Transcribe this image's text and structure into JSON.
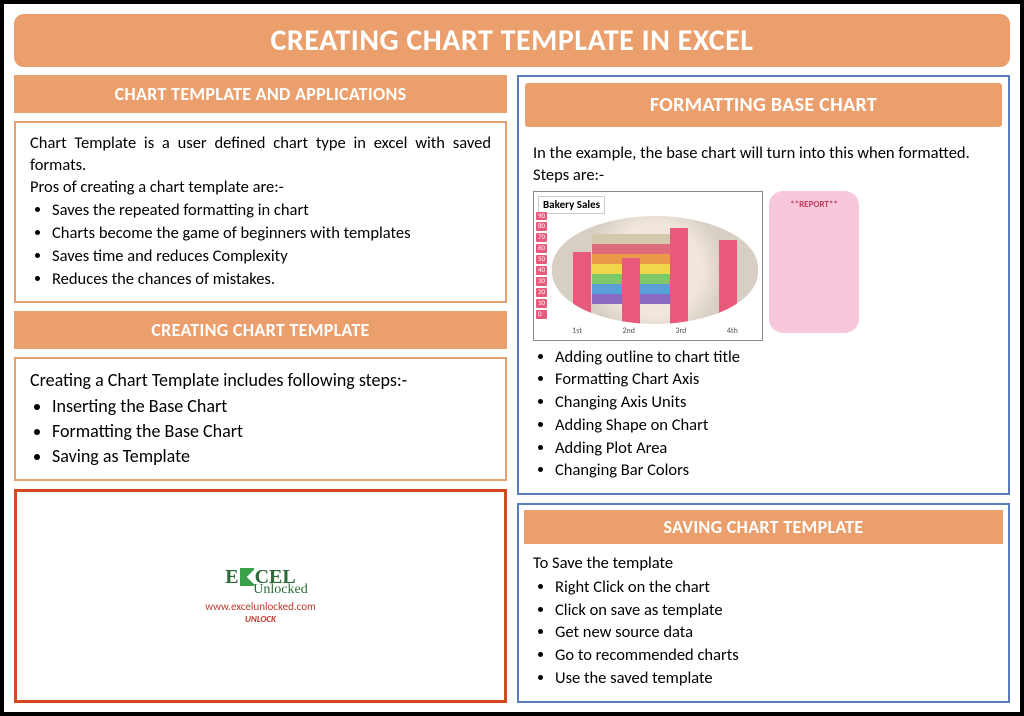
{
  "title": "CREATING CHART TEMPLATE IN EXCEL",
  "left": {
    "sec1_header": "CHART TEMPLATE AND APPLICATIONS",
    "sec1_intro": "Chart Template is a user defined chart type in excel with saved formats.",
    "sec1_pros_label": "Pros of creating a chart template are:-",
    "sec1_bullets": [
      "Saves the repeated formatting in chart",
      "Charts become the game of beginners with templates",
      "Saves time and reduces Complexity",
      "Reduces the chances of mistakes."
    ],
    "sec2_header": "CREATING CHART TEMPLATE",
    "sec2_intro": "Creating a Chart Template includes following steps:-",
    "sec2_bullets": [
      "Inserting the Base Chart",
      "Formatting the Base Chart",
      "Saving as Template"
    ],
    "logo_main1": "E",
    "logo_main2": "CEL",
    "logo_sub": "Unlocked",
    "logo_url": "www.excelunlocked.com",
    "logo_tag": "UNLOCK"
  },
  "right": {
    "sec1_header": "FORMATTING BASE CHART",
    "sec1_intro": "In the example, the base chart will turn into this when formatted. Steps are:-",
    "sec1_bullets": [
      "Adding outline to chart title",
      "Formatting Chart Axis",
      "Changing Axis Units",
      "Adding Shape on Chart",
      "Adding Plot Area",
      "Changing Bar Colors"
    ],
    "sec2_header": "SAVING CHART TEMPLATE",
    "sec2_intro": "To Save the template",
    "sec2_bullets": [
      "Right Click on the chart",
      "Click on save as template",
      "Get new source data",
      "Go to recommended charts",
      "Use the saved template"
    ]
  },
  "chart_data": {
    "type": "bar",
    "title": "Bakery Sales",
    "categories": [
      "1st",
      "2nd",
      "3rd",
      "4th"
    ],
    "values": [
      60,
      55,
      80,
      70
    ],
    "ylim": [
      0,
      90
    ],
    "yticks": [
      90,
      80,
      70,
      60,
      50,
      40,
      30,
      20,
      10,
      0
    ],
    "annotation": "**REPORT**"
  }
}
